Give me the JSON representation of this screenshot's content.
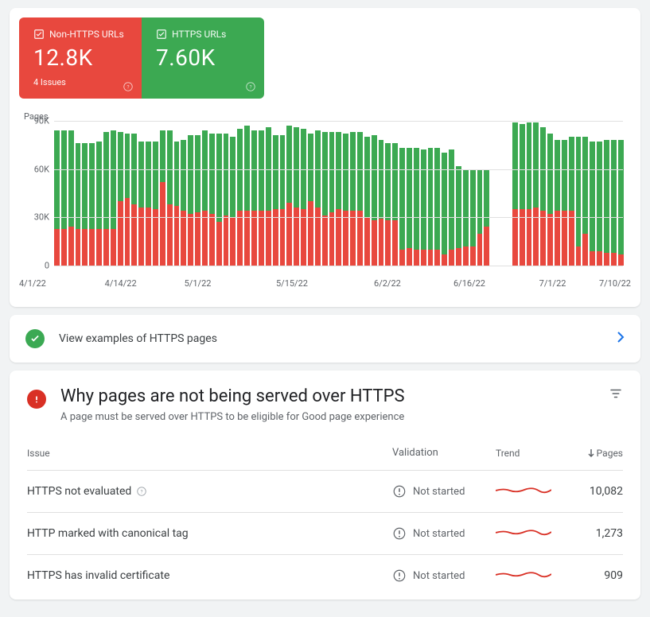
{
  "stats": {
    "non_https": {
      "label": "Non-HTTPS URLs",
      "value": "12.8K",
      "issues": "4 Issues"
    },
    "https": {
      "label": "HTTPS URLs",
      "value": "7.60K"
    }
  },
  "chart_data": {
    "type": "bar",
    "title": "",
    "xlabel": "",
    "ylabel": "Pages",
    "ylim": [
      0,
      90000
    ],
    "yticks": [
      "90K",
      "60K",
      "30K",
      "0"
    ],
    "x_tick_labels": [
      "4/1/22",
      "4/14/22",
      "5/1/22",
      "5/15/22",
      "6/2/22",
      "6/16/22",
      "7/1/22",
      "7/10/22"
    ],
    "x_tick_positions": [
      0,
      14,
      27,
      42,
      58,
      71,
      85,
      96
    ],
    "series_names": [
      "Non-HTTPS URLs",
      "HTTPS URLs"
    ],
    "categories_start": "4/1/22",
    "categories_end": "7/10/22",
    "series": [
      {
        "name": "Non-HTTPS URLs",
        "values": [
          23000,
          23000,
          24000,
          23000,
          23000,
          23000,
          23000,
          23000,
          23000,
          40000,
          42000,
          38000,
          36000,
          36000,
          35000,
          52000,
          38000,
          37000,
          34000,
          32000,
          33000,
          34000,
          32000,
          27000,
          31000,
          30000,
          34000,
          34000,
          34000,
          34000,
          34000,
          35000,
          35000,
          39000,
          36000,
          35000,
          40000,
          36000,
          31000,
          33000,
          35000,
          34000,
          34000,
          34000,
          30000,
          28000,
          29000,
          28000,
          28000,
          10000,
          11000,
          10000,
          10000,
          10000,
          10000,
          7000,
          10000,
          11000,
          12000,
          12000,
          20000,
          24000,
          0,
          0,
          0,
          35000,
          35000,
          35000,
          36000,
          34000,
          32000,
          34000,
          34000,
          34000,
          12000,
          20000,
          9000,
          9000,
          8000,
          8000,
          7000
        ]
      },
      {
        "name": "HTTPS URLs",
        "values": [
          61000,
          61000,
          60000,
          53000,
          53000,
          53000,
          54000,
          60000,
          61000,
          43000,
          40000,
          44000,
          41000,
          41000,
          42000,
          32000,
          46000,
          40000,
          44000,
          49000,
          48000,
          50000,
          50000,
          55000,
          51000,
          50000,
          51000,
          53000,
          50000,
          50000,
          52000,
          46000,
          46000,
          48000,
          50000,
          50000,
          42000,
          48000,
          52000,
          50000,
          48000,
          48000,
          49000,
          49000,
          50000,
          53000,
          49000,
          48000,
          48000,
          63000,
          62000,
          63000,
          62000,
          63000,
          63000,
          63000,
          62000,
          51000,
          48000,
          48000,
          40000,
          36000,
          0,
          0,
          0,
          54000,
          53000,
          54000,
          53000,
          52000,
          50000,
          44000,
          44000,
          46000,
          68000,
          60000,
          68000,
          68000,
          70000,
          70000,
          71000
        ]
      }
    ]
  },
  "link_row": {
    "text": "View examples of HTTPS pages"
  },
  "issues": {
    "title": "Why pages are not being served over HTTPS",
    "subtitle": "A page must be served over HTTPS to be eligible for Good page experience",
    "columns": {
      "issue": "Issue",
      "validation": "Validation",
      "trend": "Trend",
      "pages": "Pages"
    },
    "rows": [
      {
        "name": "HTTPS not evaluated",
        "has_help": true,
        "validation": "Not started",
        "pages": "10,082"
      },
      {
        "name": "HTTP marked with canonical tag",
        "has_help": false,
        "validation": "Not started",
        "pages": "1,273"
      },
      {
        "name": "HTTPS has invalid certificate",
        "has_help": false,
        "validation": "Not started",
        "pages": "909"
      }
    ]
  }
}
